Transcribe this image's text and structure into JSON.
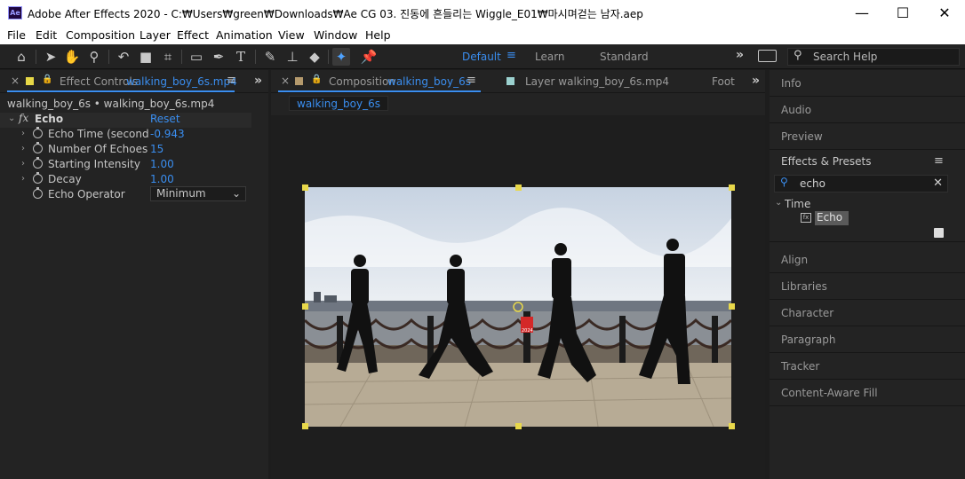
{
  "window": {
    "app_icon_text": "Ae",
    "title": "Adobe After Effects 2020 - C:₩Users₩green₩Downloads₩Ae CG 03. 진동에 흔들리는 Wiggle_E01₩마시며걷는 남자.aep",
    "minimize": "—",
    "maximize": "☐",
    "close": "✕"
  },
  "menu": [
    "File",
    "Edit",
    "Composition",
    "Layer",
    "Effect",
    "Animation",
    "View",
    "Window",
    "Help"
  ],
  "toolbar": {
    "workspaces": [
      "Default",
      "Learn",
      "Standard"
    ],
    "active_workspace": "Default",
    "search_help_placeholder": "Search Help"
  },
  "effect_controls": {
    "tab_label": "Effect Controls",
    "tab_file": "walking_boy_6s.mp4",
    "breadcrumb": "walking_boy_6s • walking_boy_6s.mp4",
    "effect_name": "Echo",
    "reset_label": "Reset",
    "properties": [
      {
        "label": "Echo Time (second",
        "value": "-0.943"
      },
      {
        "label": "Number Of Echoes",
        "value": "15"
      },
      {
        "label": "Starting Intensity",
        "value": "1.00"
      },
      {
        "label": "Decay",
        "value": "1.00"
      }
    ],
    "operator_label": "Echo Operator",
    "operator_value": "Minimum"
  },
  "composition": {
    "tab_label": "Composition",
    "tab_comp": "walking_boy_6s",
    "layer_tab": "Layer  walking_boy_6s.mp4",
    "footage_tab": "Foot",
    "sub_tab": "walking_boy_6s",
    "sign_text": "2024"
  },
  "right_panels": {
    "items_top": [
      "Info",
      "Audio",
      "Preview"
    ],
    "effects_presets_label": "Effects & Presets",
    "search_value": "echo",
    "tree_group": "Time",
    "tree_item": "Echo",
    "items_bottom": [
      "Align",
      "Libraries",
      "Character",
      "Paragraph",
      "Tracker",
      "Content-Aware Fill"
    ]
  },
  "colors": {
    "accent": "#3a8ef0",
    "effect_swatch": "#e7d847",
    "comp_swatch": "#b59a6d",
    "layer_swatch": "#9bd1cf",
    "handle": "#e8d84a"
  }
}
